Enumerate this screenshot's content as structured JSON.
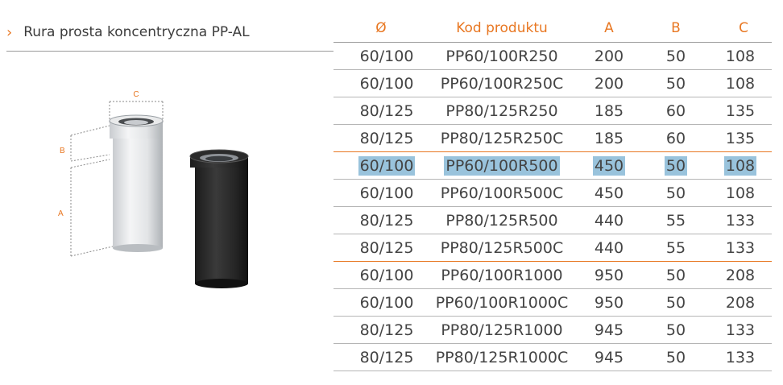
{
  "title": {
    "text": "Rura prosta koncentryczna PP-AL",
    "chevron": "›"
  },
  "diagram": {
    "label_a": "A",
    "label_b": "B",
    "label_c": "C"
  },
  "colors": {
    "accent": "#e87722",
    "selection": "#99c3dc",
    "text": "#444444"
  },
  "table": {
    "headers": [
      "Ø",
      "Kod produktu",
      "A",
      "B",
      "C"
    ],
    "rows": [
      {
        "d": "60/100",
        "code": "PP60/100R250",
        "a": "200",
        "b": "50",
        "c": "108"
      },
      {
        "d": "60/100",
        "code": "PP60/100R250C",
        "a": "200",
        "b": "50",
        "c": "108"
      },
      {
        "d": "80/125",
        "code": "PP80/125R250",
        "a": "185",
        "b": "60",
        "c": "135"
      },
      {
        "d": "80/125",
        "code": "PP80/125R250C",
        "a": "185",
        "b": "60",
        "c": "135"
      },
      {
        "d": "60/100",
        "code": "PP60/100R500",
        "a": "450",
        "b": "50",
        "c": "108"
      },
      {
        "d": "60/100",
        "code": "PP60/100R500C",
        "a": "450",
        "b": "50",
        "c": "108"
      },
      {
        "d": "80/125",
        "code": "PP80/125R500",
        "a": "440",
        "b": "55",
        "c": "133"
      },
      {
        "d": "80/125",
        "code": "PP80/125R500C",
        "a": "440",
        "b": "55",
        "c": "133"
      },
      {
        "d": "60/100",
        "code": "PP60/100R1000",
        "a": "950",
        "b": "50",
        "c": "208"
      },
      {
        "d": "60/100",
        "code": "PP60/100R1000C",
        "a": "950",
        "b": "50",
        "c": "208"
      },
      {
        "d": "80/125",
        "code": "PP80/125R1000",
        "a": "945",
        "b": "50",
        "c": "133"
      },
      {
        "d": "80/125",
        "code": "PP80/125R1000C",
        "a": "945",
        "b": "50",
        "c": "133"
      }
    ]
  }
}
